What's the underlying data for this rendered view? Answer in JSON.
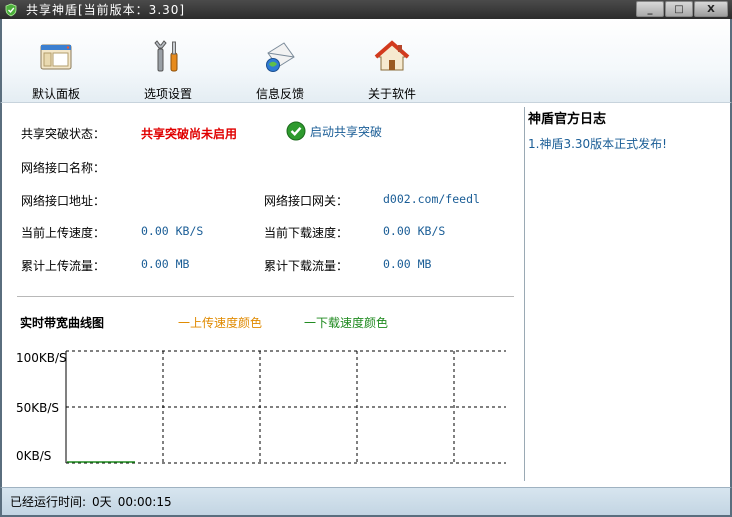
{
  "window": {
    "title": "共享神盾[当前版本：3.30]",
    "min_label": "_",
    "max_label": "□",
    "close_label": "X"
  },
  "toolbar": {
    "items": [
      {
        "label": "默认面板",
        "icon": "panel-icon"
      },
      {
        "label": "选项设置",
        "icon": "tools-icon"
      },
      {
        "label": "信息反馈",
        "icon": "feedback-mail-icon"
      },
      {
        "label": "关于软件",
        "icon": "home-icon"
      }
    ]
  },
  "status": {
    "share_break_label": "共享突破状态：",
    "share_break_value": "共享突破尚未启用",
    "start_link": "启动共享突破",
    "iface_name_label": "网络接口名称：",
    "iface_name_value": "",
    "iface_addr_label": "网络接口地址：",
    "iface_addr_value": "",
    "gateway_label": "网络接口网关：",
    "gateway_value": "d002.com/feedl",
    "upload_speed_label": "当前上传速度：",
    "upload_speed_value": "0.00 KB/S",
    "download_speed_label": "当前下载速度：",
    "download_speed_value": "0.00 KB/S",
    "upload_total_label": "累计上传流量：",
    "upload_total_value": "0.00 MB",
    "download_total_label": "累计下载流量：",
    "download_total_value": "0.00 MB"
  },
  "bandwidth": {
    "title": "实时带宽曲线图",
    "legend_upload": "一上传速度颜色",
    "legend_download": "一下载速度颜色",
    "upload_color": "#e08a00",
    "download_color": "#1f8a1f",
    "y_labels": [
      "100KB/S",
      "50KB/S",
      "0KB/S"
    ]
  },
  "sidebar": {
    "title": "神盾官方日志",
    "items": [
      "1.神盾3.30版本正式发布!"
    ]
  },
  "statusbar": {
    "runtime_label": "已经运行时间:",
    "runtime_days": "0天",
    "runtime_time": "00:00:15"
  }
}
